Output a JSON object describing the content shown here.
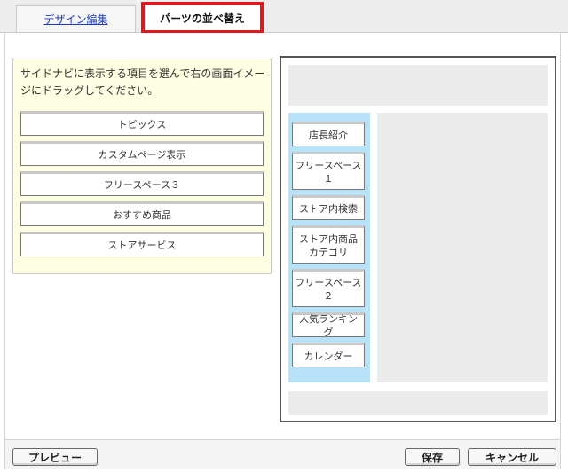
{
  "tabs": {
    "design_edit": "デザイン編集",
    "parts_sort": "パーツの並べ替え"
  },
  "left_panel": {
    "instruction": "サイドナビに表示する項目を選んで右の画面イメージにドラッグしてください。",
    "parts": [
      "トピックス",
      "カスタムページ表示",
      "フリースペース３",
      "おすすめ商品",
      "ストアサービス"
    ]
  },
  "preview": {
    "side_items": [
      "店長紹介",
      "フリースペース１",
      "ストア内検索",
      "ストア内商品カテゴリ",
      "フリースペース２",
      "人気ランキング",
      "カレンダー"
    ]
  },
  "buttons": {
    "preview": "プレビュー",
    "save": "保存",
    "cancel": "キャンセル"
  },
  "colors": {
    "active_tab_border": "#e0181e",
    "side_nav_bg": "#b8e2f8",
    "instruction_bg": "#fefee2"
  }
}
